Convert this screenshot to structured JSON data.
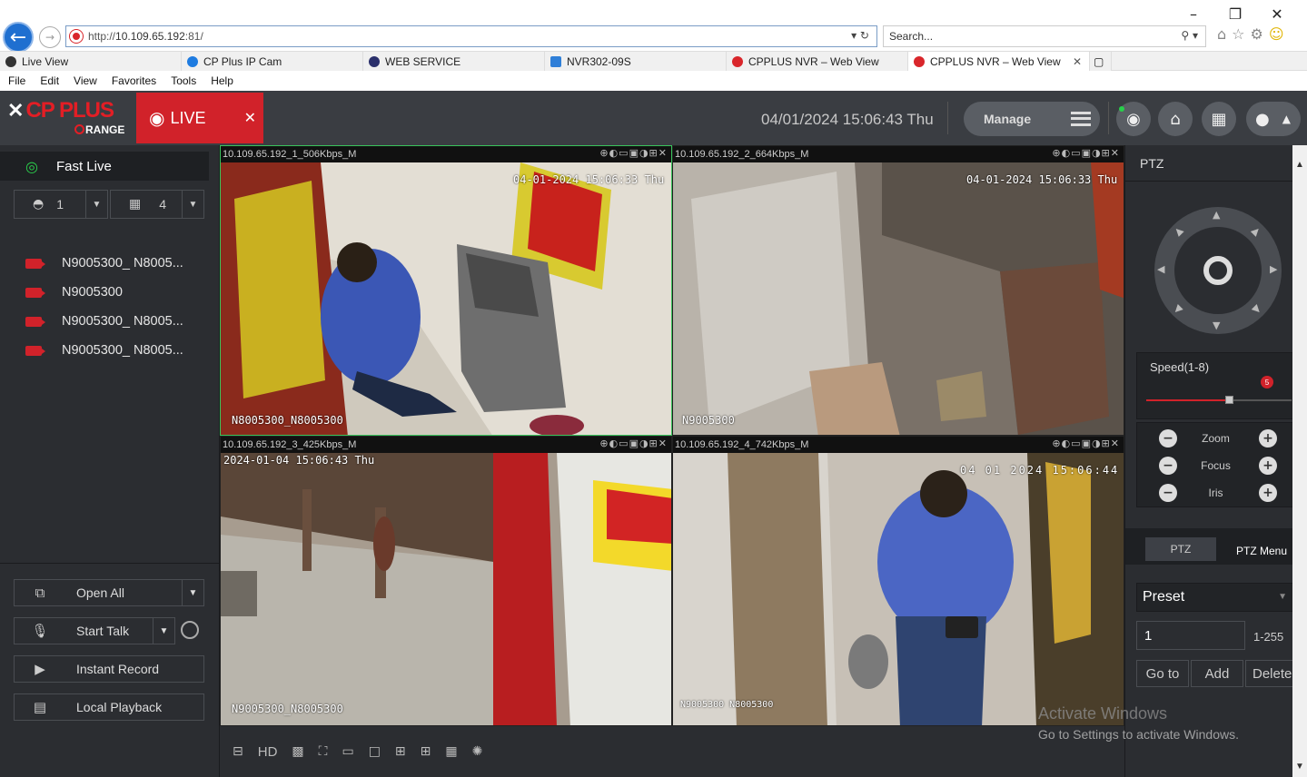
{
  "browser": {
    "window_controls": [
      "–",
      "❐",
      "✕"
    ],
    "address": {
      "prefix": "http://",
      "host": "10.109.65.192",
      "port": ":81/"
    },
    "search_placeholder": "Search...",
    "tabs": [
      {
        "label": "Live View",
        "color": "#333333"
      },
      {
        "label": "CP Plus IP Cam",
        "color": "#1e7be0"
      },
      {
        "label": "WEB SERVICE",
        "color": "#2a2f6b"
      },
      {
        "label": "NVR302-09S",
        "color": "#2f7fd8"
      },
      {
        "label": "CPPLUS NVR – Web View",
        "color": "#d9262b"
      },
      {
        "label": "CPPLUS NVR – Web View",
        "color": "#d9262b",
        "active": true
      }
    ],
    "menu": [
      "File",
      "Edit",
      "View",
      "Favorites",
      "Tools",
      "Help"
    ]
  },
  "app": {
    "logo": {
      "brand": "CP PLUS",
      "sub": "RANGE"
    },
    "live_tab": "LIVE",
    "clock": "04/01/2024 15:06:43 Thu",
    "manage_label": "Manage",
    "accent": "#d1222a"
  },
  "left": {
    "fast_live": "Fast Live",
    "stream_select": "1",
    "layout_select": "4",
    "cameras": [
      "N9005300_ N8005...",
      "N9005300",
      "N9005300_ N8005...",
      "N9005300_ N8005..."
    ],
    "buttons": {
      "open_all": "Open All",
      "start_talk": "Start Talk",
      "instant_record": "Instant Record",
      "local_playback": "Local Playback"
    }
  },
  "tiles": [
    {
      "title": "10.109.65.192_1_506Kbps_M",
      "osd_time": "04-01-2024 15:06:33 Thu",
      "osd_name": "N8005300_N8005300"
    },
    {
      "title": "10.109.65.192_2_664Kbps_M",
      "osd_time": "04-01-2024 15:06:33 Thu",
      "osd_name": "N9005300"
    },
    {
      "title": "10.109.65.192_3_425Kbps_M",
      "osd_time": "2024-01-04 15:06:43 Thu",
      "osd_name": "N9005300_N8005300"
    },
    {
      "title": "10.109.65.192_4_742Kbps_M",
      "osd_time": "04 01 2024 15:06:44",
      "osd_name": "N9005300 N8005300"
    }
  ],
  "bottom_toolbar": {
    "hd_label": "HD"
  },
  "ptz": {
    "header": "PTZ",
    "speed_label": "Speed(1-8)",
    "speed_value": "5",
    "speed_fraction": 0.57,
    "zoom": "Zoom",
    "focus": "Focus",
    "iris": "Iris",
    "tab_ptz": "PTZ",
    "tab_menu": "PTZ Menu",
    "preset_label": "Preset",
    "preset_value": "1",
    "preset_range": "1-255",
    "goto": "Go to",
    "add": "Add",
    "delete": "Delete"
  },
  "watermark": {
    "line1": "Activate Windows",
    "line2": "Go to Settings to activate Windows."
  }
}
